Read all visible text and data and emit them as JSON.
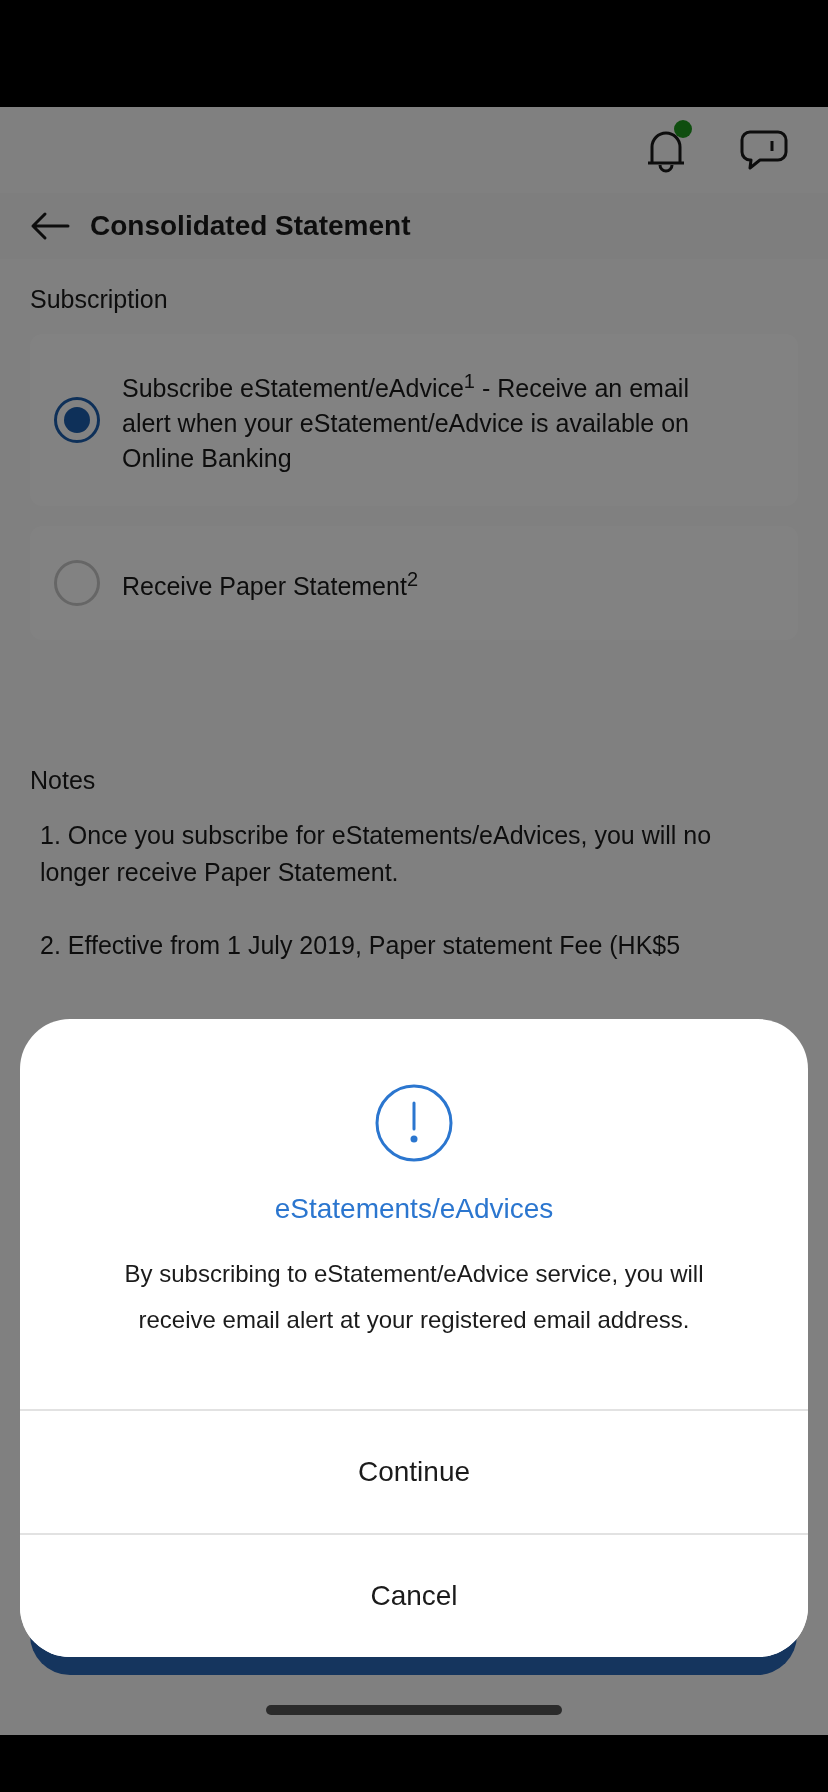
{
  "toolbar": {
    "notification_dot": true
  },
  "header": {
    "title": "Consolidated Statement"
  },
  "subscription": {
    "label": "Subscription",
    "options": [
      {
        "text": "Subscribe eStatement/eAdvice$^{1}$ - Receive an email alert when your eStatement/eAdvice is available on Online Banking",
        "selected": true
      },
      {
        "text": "Receive Paper Statement$^{2}$",
        "selected": false
      }
    ]
  },
  "notes": {
    "label": "Notes",
    "items": [
      "1. Once you subscribe for eStatements/eAdvices, you will no longer receive Paper Statement.",
      "2. Effective from 1 July 2019, Paper statement Fee (HK$5"
    ]
  },
  "dialog": {
    "title": "eStatements/eAdvices",
    "message": "By subscribing to eStatement/eAdvice service, you will receive email alert at your registered email address.",
    "buttons": [
      "Continue",
      "Cancel"
    ]
  }
}
